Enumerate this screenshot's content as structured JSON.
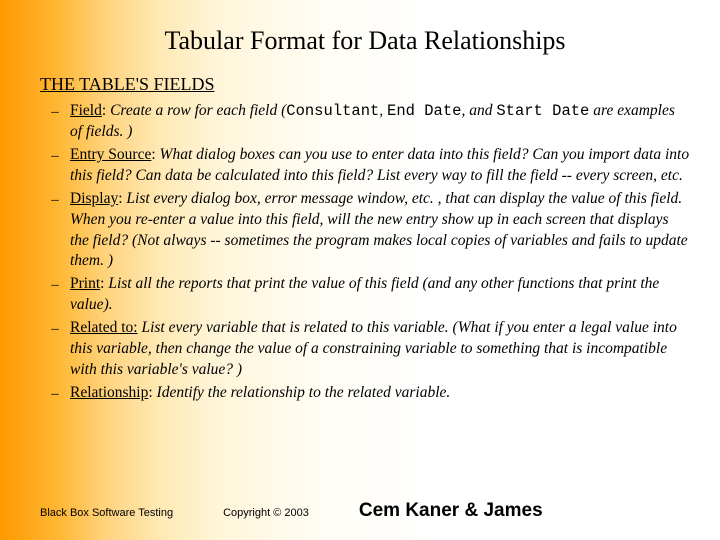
{
  "title": "Tabular Format for Data Relationships",
  "heading": "THE TABLE'S FIELDS",
  "dash": "–",
  "items": [
    {
      "label": "Field",
      "sep": ": ",
      "desc_pre": "Create a row for each field (",
      "mono1": "Consultant",
      "mid1": ", ",
      "mono2": "End Date",
      "mid2": ", and ",
      "mono3": "Start Date",
      "desc_post": " are examples of fields. )"
    },
    {
      "label": "Entry Source",
      "sep": ": ",
      "desc": "What dialog boxes can you use to enter data into this field? Can you import data into this field? Can data be calculated into this field? List every way to fill the field -- every screen, etc."
    },
    {
      "label": "Display",
      "sep": ": ",
      "desc": "List every dialog box, error message window, etc. , that can display the value of this field. When you re-enter a value into this field, will the new entry show up in each screen that displays the field? (Not always -- sometimes the program makes local copies of variables and fails to update them. )"
    },
    {
      "label": "Print",
      "sep": ": ",
      "desc": "List all the reports that print the value of this field (and any other functions that print the value)."
    },
    {
      "label": "Related to:",
      "sep": " ",
      "desc": "List every variable that is related to this variable. (What if you enter a legal value into this variable, then change the value of a constraining variable to something that is incompatible with this variable's value? )"
    },
    {
      "label": "Relationship",
      "sep": ": ",
      "desc": "Identify the relationship to the related variable."
    }
  ],
  "footer": {
    "left": "Black Box Software Testing",
    "mid_prefix": "Copyright ©",
    "mid_year": " 2003",
    "right": "Cem Kaner & James"
  }
}
